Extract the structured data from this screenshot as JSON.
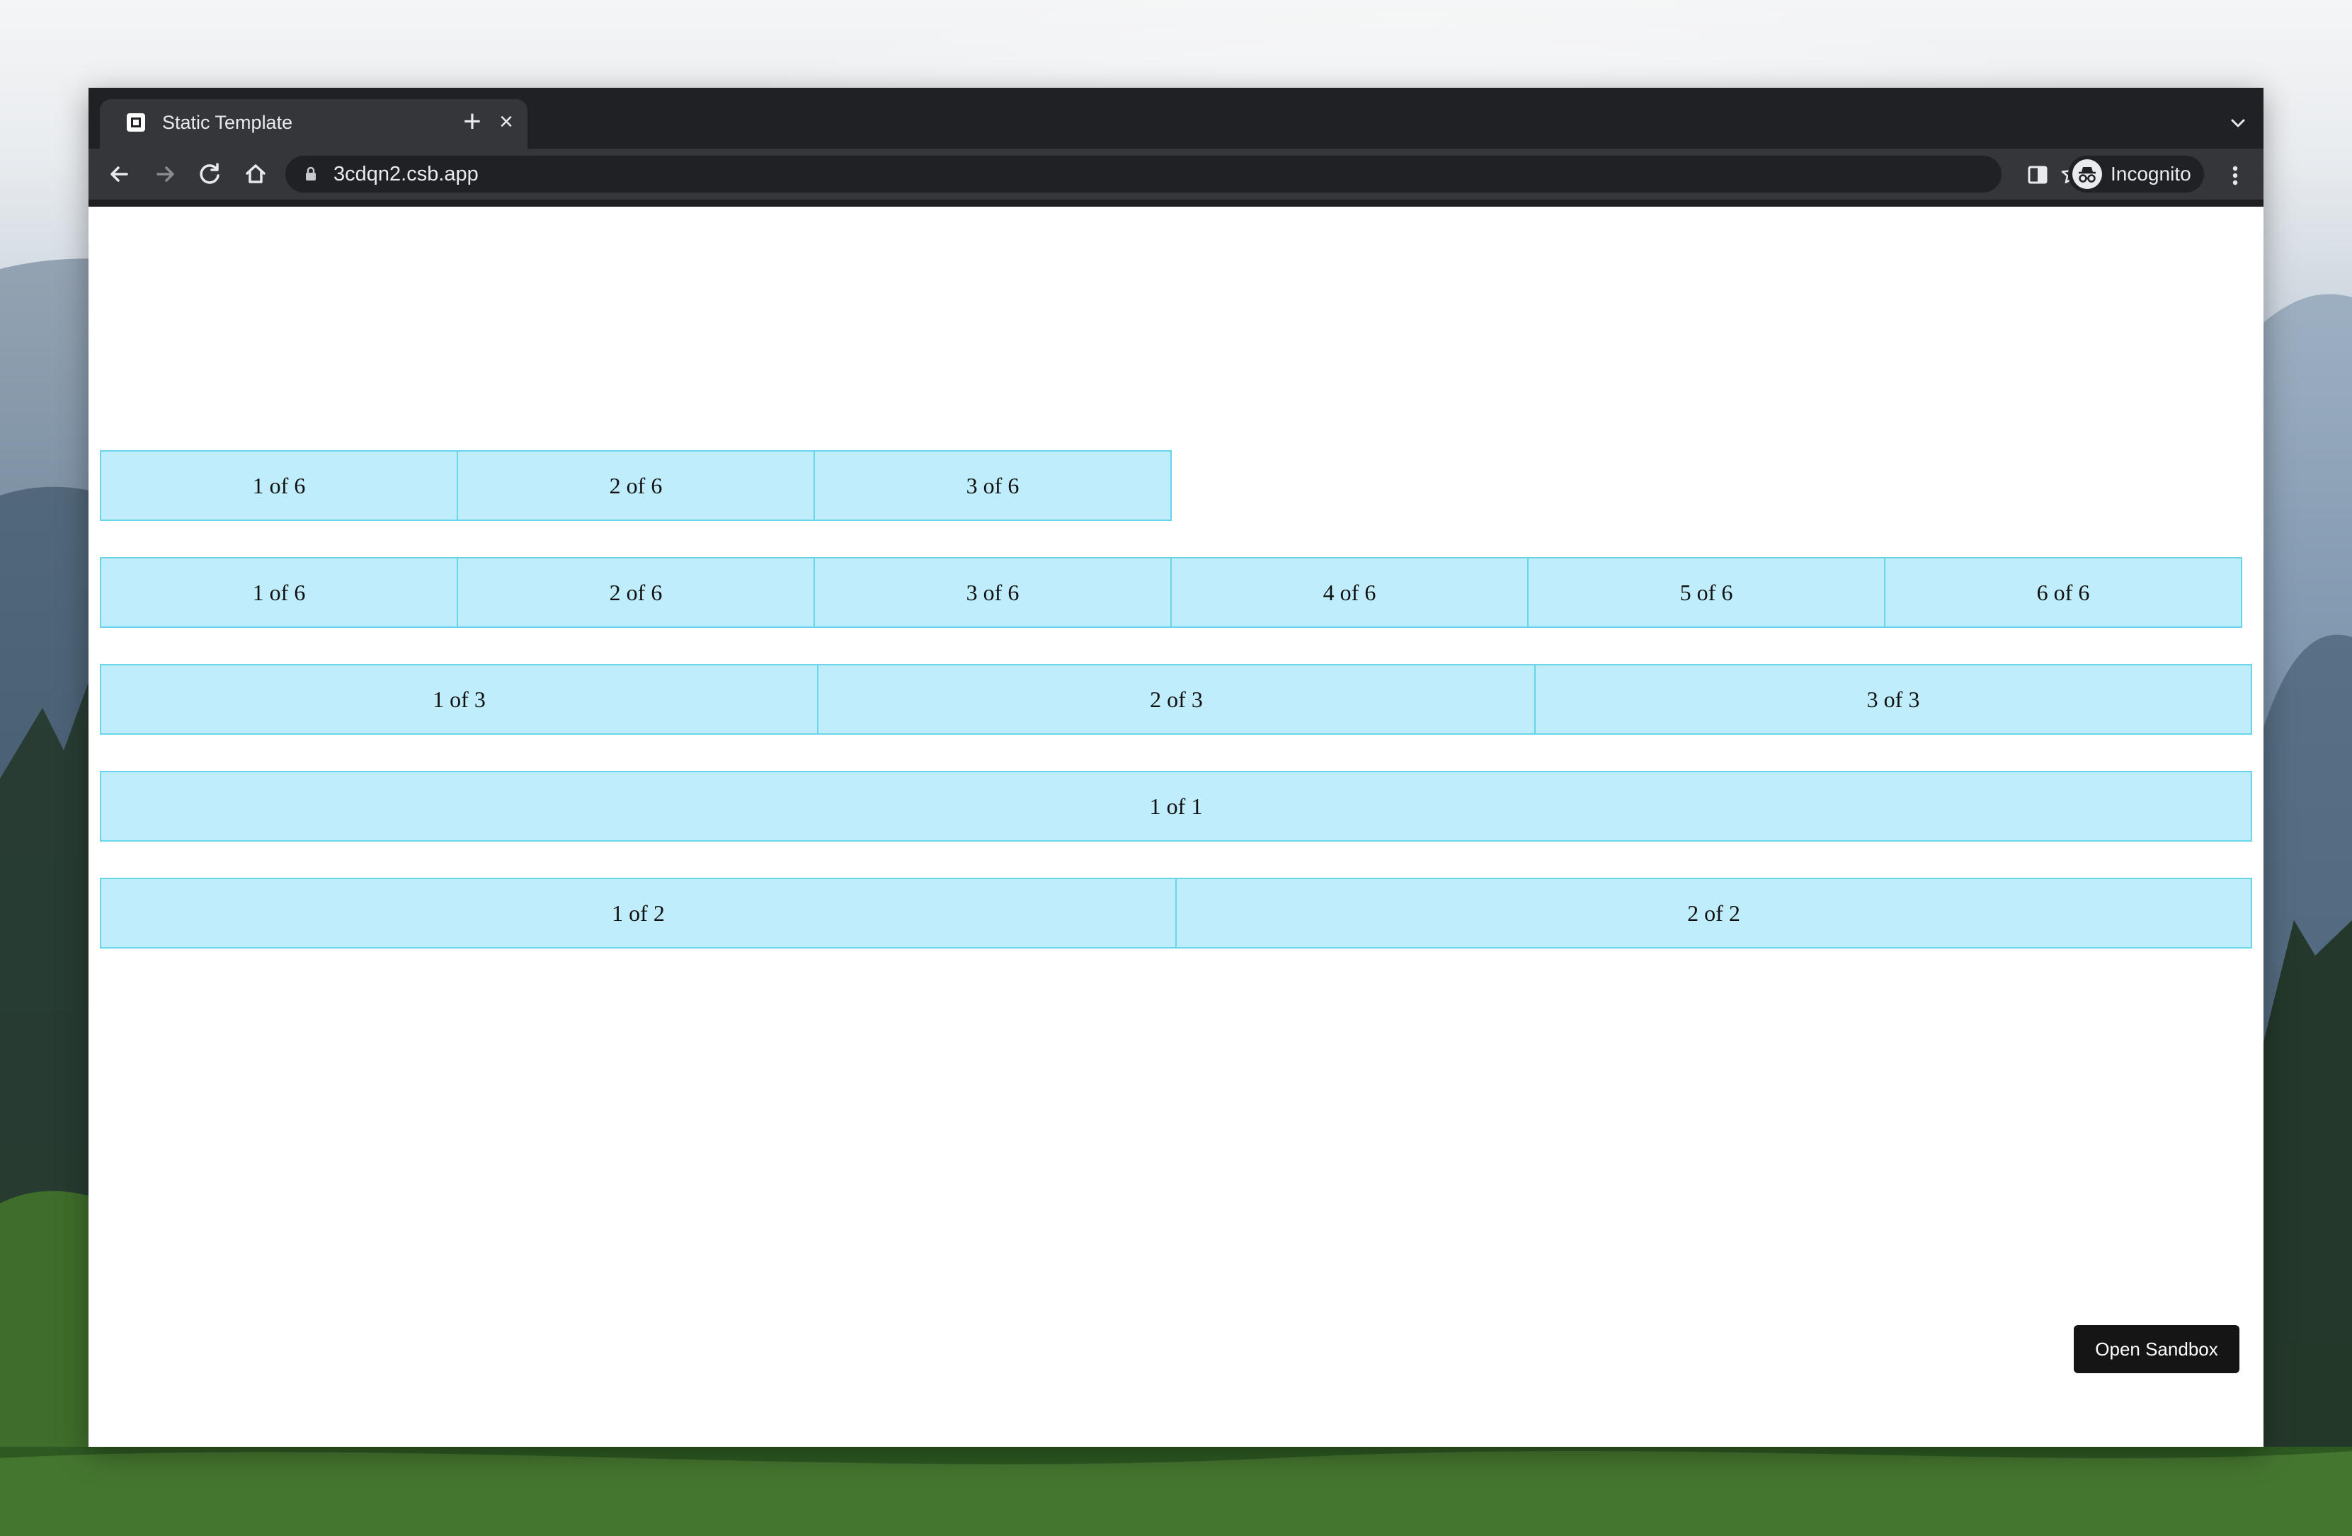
{
  "browser": {
    "tab": {
      "title": "Static Template",
      "close_icon": "close-icon",
      "favicon_icon": "square-favicon-icon"
    },
    "new_tab_icon": "plus-icon",
    "tab_search_icon": "chevron-down-icon",
    "toolbar": {
      "back_icon": "arrow-left-icon",
      "forward_icon": "arrow-right-icon",
      "reload_icon": "reload-icon",
      "home_icon": "home-icon",
      "url": "3cdqn2.csb.app",
      "lock_icon": "lock-icon",
      "bookmark_icon": "star-icon",
      "side_panel_icon": "side-panel-icon",
      "profile_label": "Incognito",
      "profile_icon": "incognito-icon",
      "menu_icon": "kebab-menu-icon"
    }
  },
  "page": {
    "rows": [
      {
        "cells": [
          "1 of 6",
          "2 of 6",
          "3 of 6"
        ]
      },
      {
        "cells": [
          "1 of 6",
          "2 of 6",
          "3 of 6",
          "4 of 6",
          "5 of 6",
          "6 of 6"
        ]
      },
      {
        "cells": [
          "1 of 3",
          "2 of 3",
          "3 of 3"
        ]
      },
      {
        "cells": [
          "1 of 1"
        ]
      },
      {
        "cells": [
          "1 of 2",
          "2 of 2"
        ]
      }
    ],
    "cell_color": "#bfedfb",
    "cell_border_color": "#6ad4ea",
    "open_sandbox_label": "Open Sandbox"
  }
}
